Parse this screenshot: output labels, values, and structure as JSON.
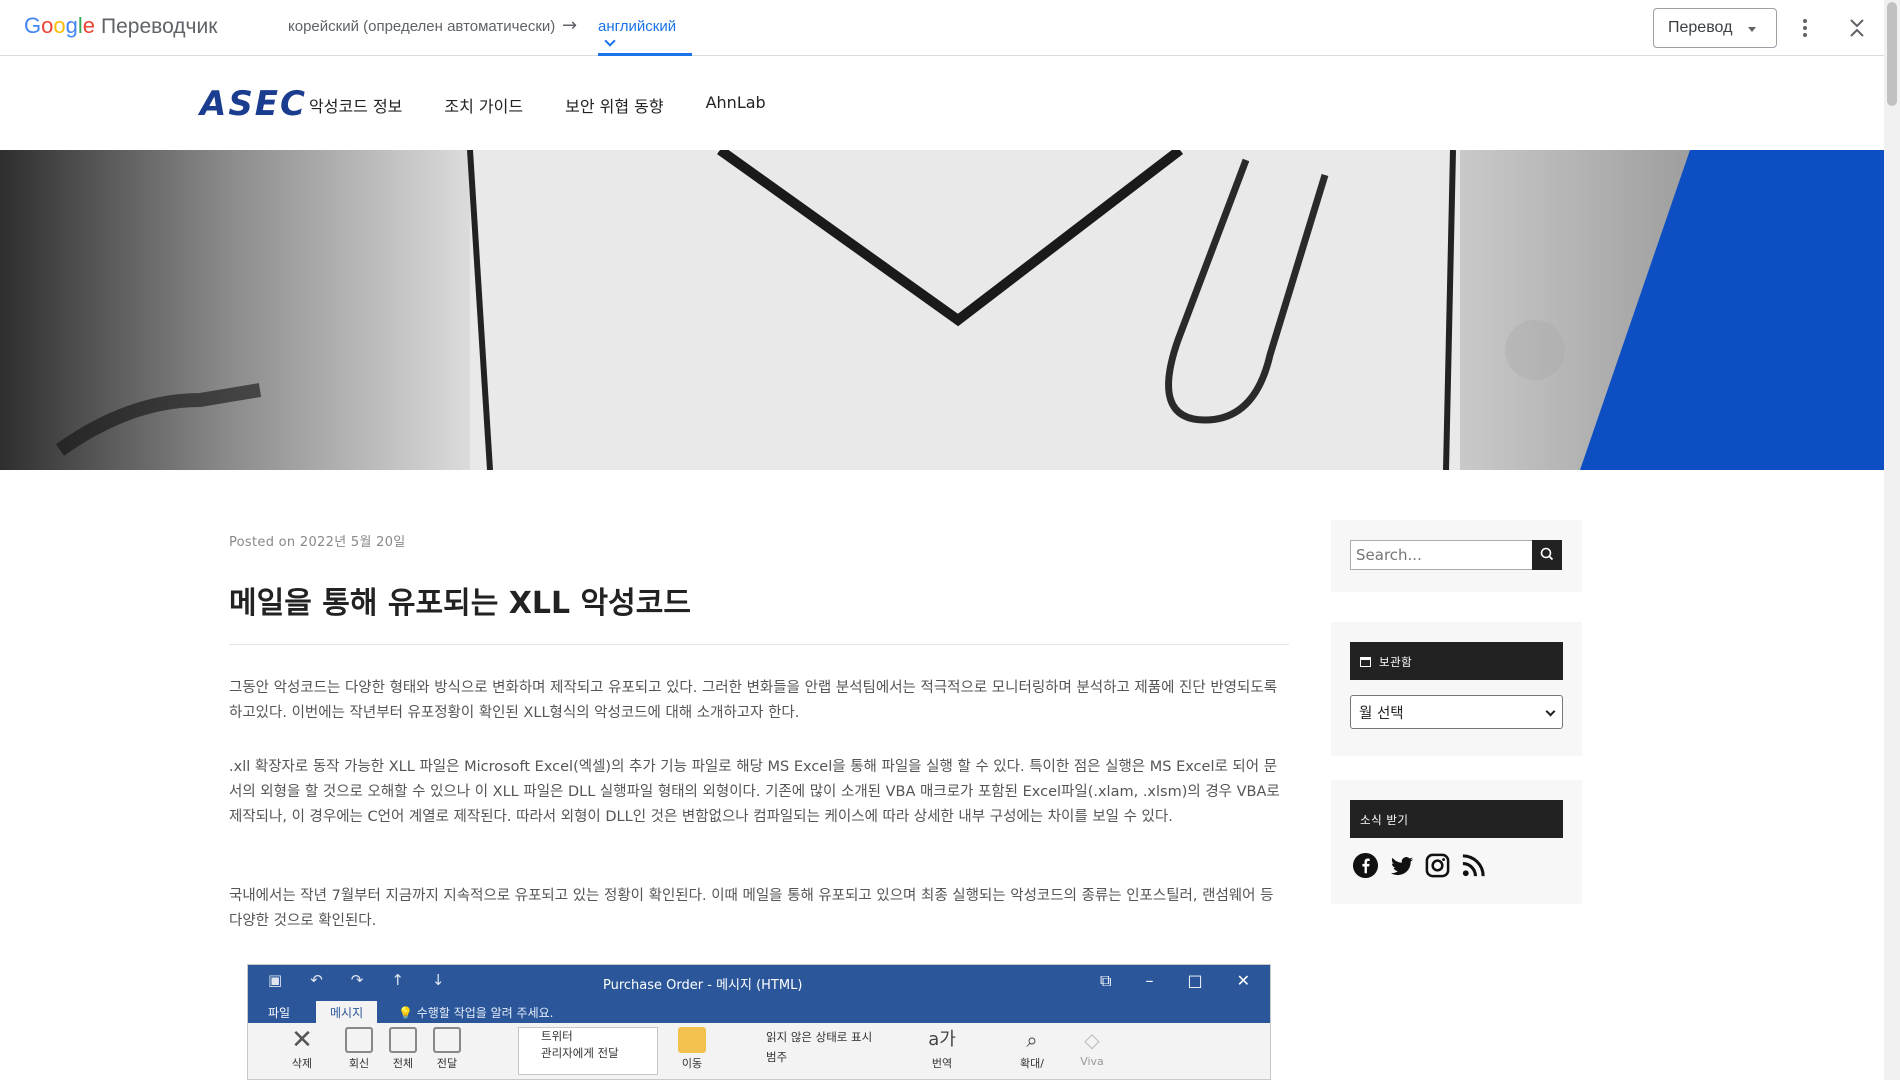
{
  "translate_bar": {
    "logo_google": [
      "G",
      "o",
      "o",
      "g",
      "l",
      "e"
    ],
    "product": "Переводчик",
    "source_lang": "корейский (определен автоматически)",
    "arrow": "→",
    "target_lang": "английский",
    "translate_button": "Перевод"
  },
  "site": {
    "logo": "ASEC",
    "nav": [
      "악성코드 정보",
      "조치 가이드",
      "보안 위협 동향",
      "AhnLab"
    ]
  },
  "post": {
    "meta": "Posted on 2022년 5월 20일",
    "title": "메일을 통해 유포되는 XLL 악성코드",
    "p1": "그동안 악성코드는 다양한 형태와 방식으로 변화하며 제작되고 유포되고 있다. 그러한 변화들을 안랩 분석팀에서는 적극적으로 모니터링하며 분석하고 제품에 진단 반영되도록 하고있다. 이번에는 작년부터 유포정황이 확인된 XLL형식의 악성코드에 대해 소개하고자 한다.",
    "p2": ".xll 확장자로 동작 가능한 XLL 파일은 Microsoft Excel(엑셀)의 추가 기능 파일로 해당 MS Excel을 통해 파일을 실행 할 수 있다. 특이한 점은 실행은 MS Excel로 되어 문서의 외형을 할 것으로 오해할 수 있으나 이 XLL 파일은 DLL 실행파일 형태의 외형이다. 기존에 많이 소개된 VBA 매크로가 포함된 Excel파일(.xlam, .xlsm)의 경우 VBA로 제작되나, 이 경우에는 C언어 계열로 제작된다. 따라서 외형이 DLL인 것은 변함없으나 컴파일되는 케이스에 따라 상세한 내부 구성에는 차이를 보일 수 있다.",
    "p3": "국내에서는 작년 7월부터 지금까지 지속적으로 유포되고 있는 정황이 확인된다. 이때 메일을 통해 유포되고 있으며 최종 실행되는 악성코드의 종류는 인포스틸러, 랜섬웨어 등 다양한 것으로 확인된다."
  },
  "screenshot": {
    "window_title": "Purchase Order - 메시지 (HTML)",
    "tab_file": "파일",
    "tab_message": "메시지",
    "tell_me": "수행할 작업을 알려 주세요.",
    "btn_delete": "삭제",
    "btn_reply": "회신",
    "btn_reply_all": "전체",
    "btn_forward": "전달",
    "quick_steps": [
      "트위터",
      "관리자에게 전달"
    ],
    "btn_move": "이동",
    "unread": "읽지 않은 상태로 표시",
    "category": "범주",
    "btn_translate": "번역",
    "btn_zoom": "확대/",
    "btn_viva": "Viva"
  },
  "sidebar": {
    "search_placeholder": "Search...",
    "archive_title": "보관함",
    "archive_select": "월 선택",
    "follow_title": "소식 받기",
    "social": [
      "facebook-icon",
      "twitter-icon",
      "instagram-icon",
      "rss-icon"
    ]
  },
  "colors": {
    "google_blue": "#1a73e8",
    "outlook_blue": "#2b579a",
    "asec_blue": "#1b3d8f",
    "hero_accent": "#0d4fc2"
  }
}
